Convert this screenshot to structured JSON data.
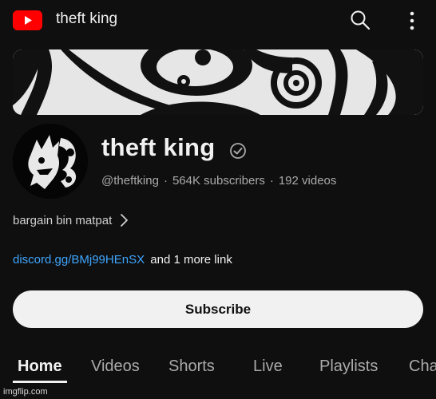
{
  "topbar": {
    "title": "theft king",
    "icons": [
      "youtube-logo",
      "search-icon",
      "more-vertical-icon"
    ]
  },
  "channel": {
    "name": "theft king",
    "handle": "@theftking",
    "subscribers": "564K subscribers",
    "videos": "192 videos",
    "separator": "·",
    "description": "bargain bin matpat",
    "link": "discord.gg/BMj99HEnSX",
    "more_links": "and 1 more link"
  },
  "subscribe_label": "Subscribe",
  "tabs": [
    {
      "label": "Home",
      "active": true
    },
    {
      "label": "Videos",
      "active": false
    },
    {
      "label": "Shorts",
      "active": false
    },
    {
      "label": "Live",
      "active": false
    },
    {
      "label": "Playlists",
      "active": false
    },
    {
      "label": "Cha",
      "active": false
    }
  ],
  "watermark": "imgflip.com",
  "colors": {
    "background": "#0f0f0f",
    "text": "#f1f1f1",
    "secondary_text": "#aaaaaa",
    "link": "#3ea6ff",
    "youtube_red": "#ff0000",
    "subscribe_bg": "#f1f1f1"
  }
}
